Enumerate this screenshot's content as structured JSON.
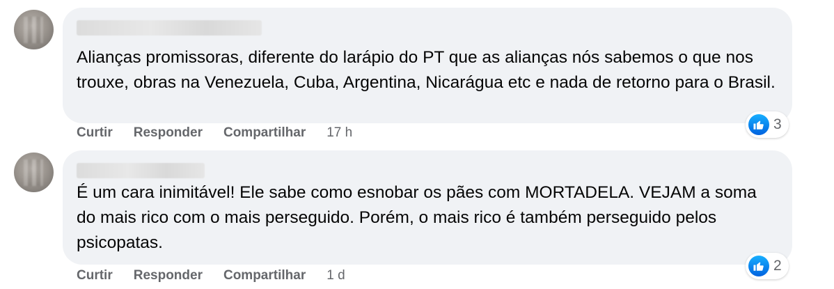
{
  "comments": [
    {
      "text": "Alianças promissoras, diferente do larápio do PT que as alianças nós sabemos o que nos trouxe, obras na Venezuela, Cuba, Argentina, Nicarágua etc e nada de retorno para o Brasil.",
      "actions": {
        "like": "Curtir",
        "reply": "Responder",
        "share": "Compartilhar",
        "time": "17 h"
      },
      "reaction_icon": "like-icon",
      "reaction_count": "3"
    },
    {
      "text": "É um cara inimitável! Ele sabe como esnobar os pães com MORTADELA. VEJAM a soma do mais rico com o mais perseguido. Porém, o mais rico é também perseguido pelos psicopatas.",
      "actions": {
        "like": "Curtir",
        "reply": "Responder",
        "share": "Compartilhar",
        "time": "1 d"
      },
      "reaction_icon": "like-icon",
      "reaction_count": "2"
    }
  ],
  "colors": {
    "bubble": "#f0f2f5",
    "action_text": "#65676b",
    "like_blue": "#1877f2"
  }
}
